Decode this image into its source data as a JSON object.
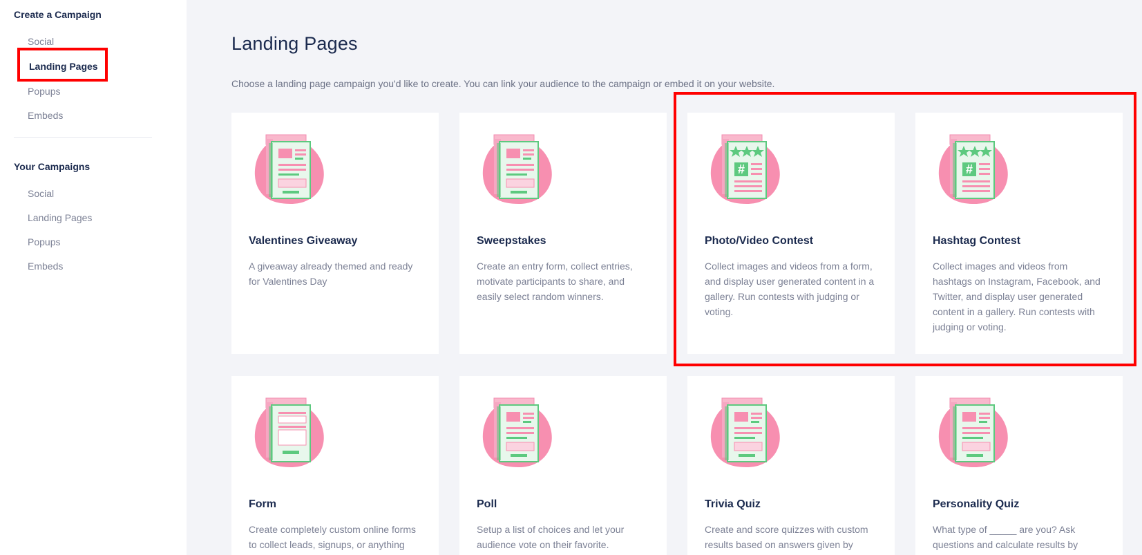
{
  "sidebar": {
    "create_heading": "Create a Campaign",
    "create_items": [
      "Social",
      "Landing Pages",
      "Popups",
      "Embeds"
    ],
    "campaigns_heading": "Your Campaigns",
    "campaign_items": [
      "Social",
      "Landing Pages",
      "Popups",
      "Embeds"
    ]
  },
  "main": {
    "title": "Landing Pages",
    "subtitle": "Choose a landing page campaign you'd like to create. You can link your audience to the campaign or embed it on your website.",
    "cards": [
      {
        "title": "Valentines Giveaway",
        "desc": "A giveaway already themed and ready for Valentines Day",
        "icon": "landing-page-illustration"
      },
      {
        "title": "Sweepstakes",
        "desc": "Create an entry form, collect entries, motivate participants to share, and easily select random winners.",
        "icon": "landing-page-illustration"
      },
      {
        "title": "Photo/Video Contest",
        "desc": "Collect images and videos from a form, and display user generated content in a gallery. Run contests with judging or voting.",
        "icon": "hashtag-contest-illustration"
      },
      {
        "title": "Hashtag Contest",
        "desc": "Collect images and videos from hashtags on Instagram, Facebook, and Twitter, and display user generated content in a gallery. Run contests with judging or voting.",
        "icon": "hashtag-contest-illustration"
      },
      {
        "title": "Form",
        "desc": "Create completely custom online forms to collect leads, signups, or anything",
        "icon": "form-illustration"
      },
      {
        "title": "Poll",
        "desc": "Setup a list of choices and let your audience vote on their favorite.",
        "icon": "landing-page-illustration"
      },
      {
        "title": "Trivia Quiz",
        "desc": "Create and score quizzes with custom results based on answers given by",
        "icon": "landing-page-illustration"
      },
      {
        "title": "Personality Quiz",
        "desc": "What type of _____ are you? Ask questions and calculate results by",
        "icon": "landing-page-illustration"
      }
    ]
  },
  "colors": {
    "accent_pink": "#f78fb0",
    "accent_green": "#5dc97f",
    "highlight_red": "#ff0000",
    "heading": "#1b2a4e"
  }
}
